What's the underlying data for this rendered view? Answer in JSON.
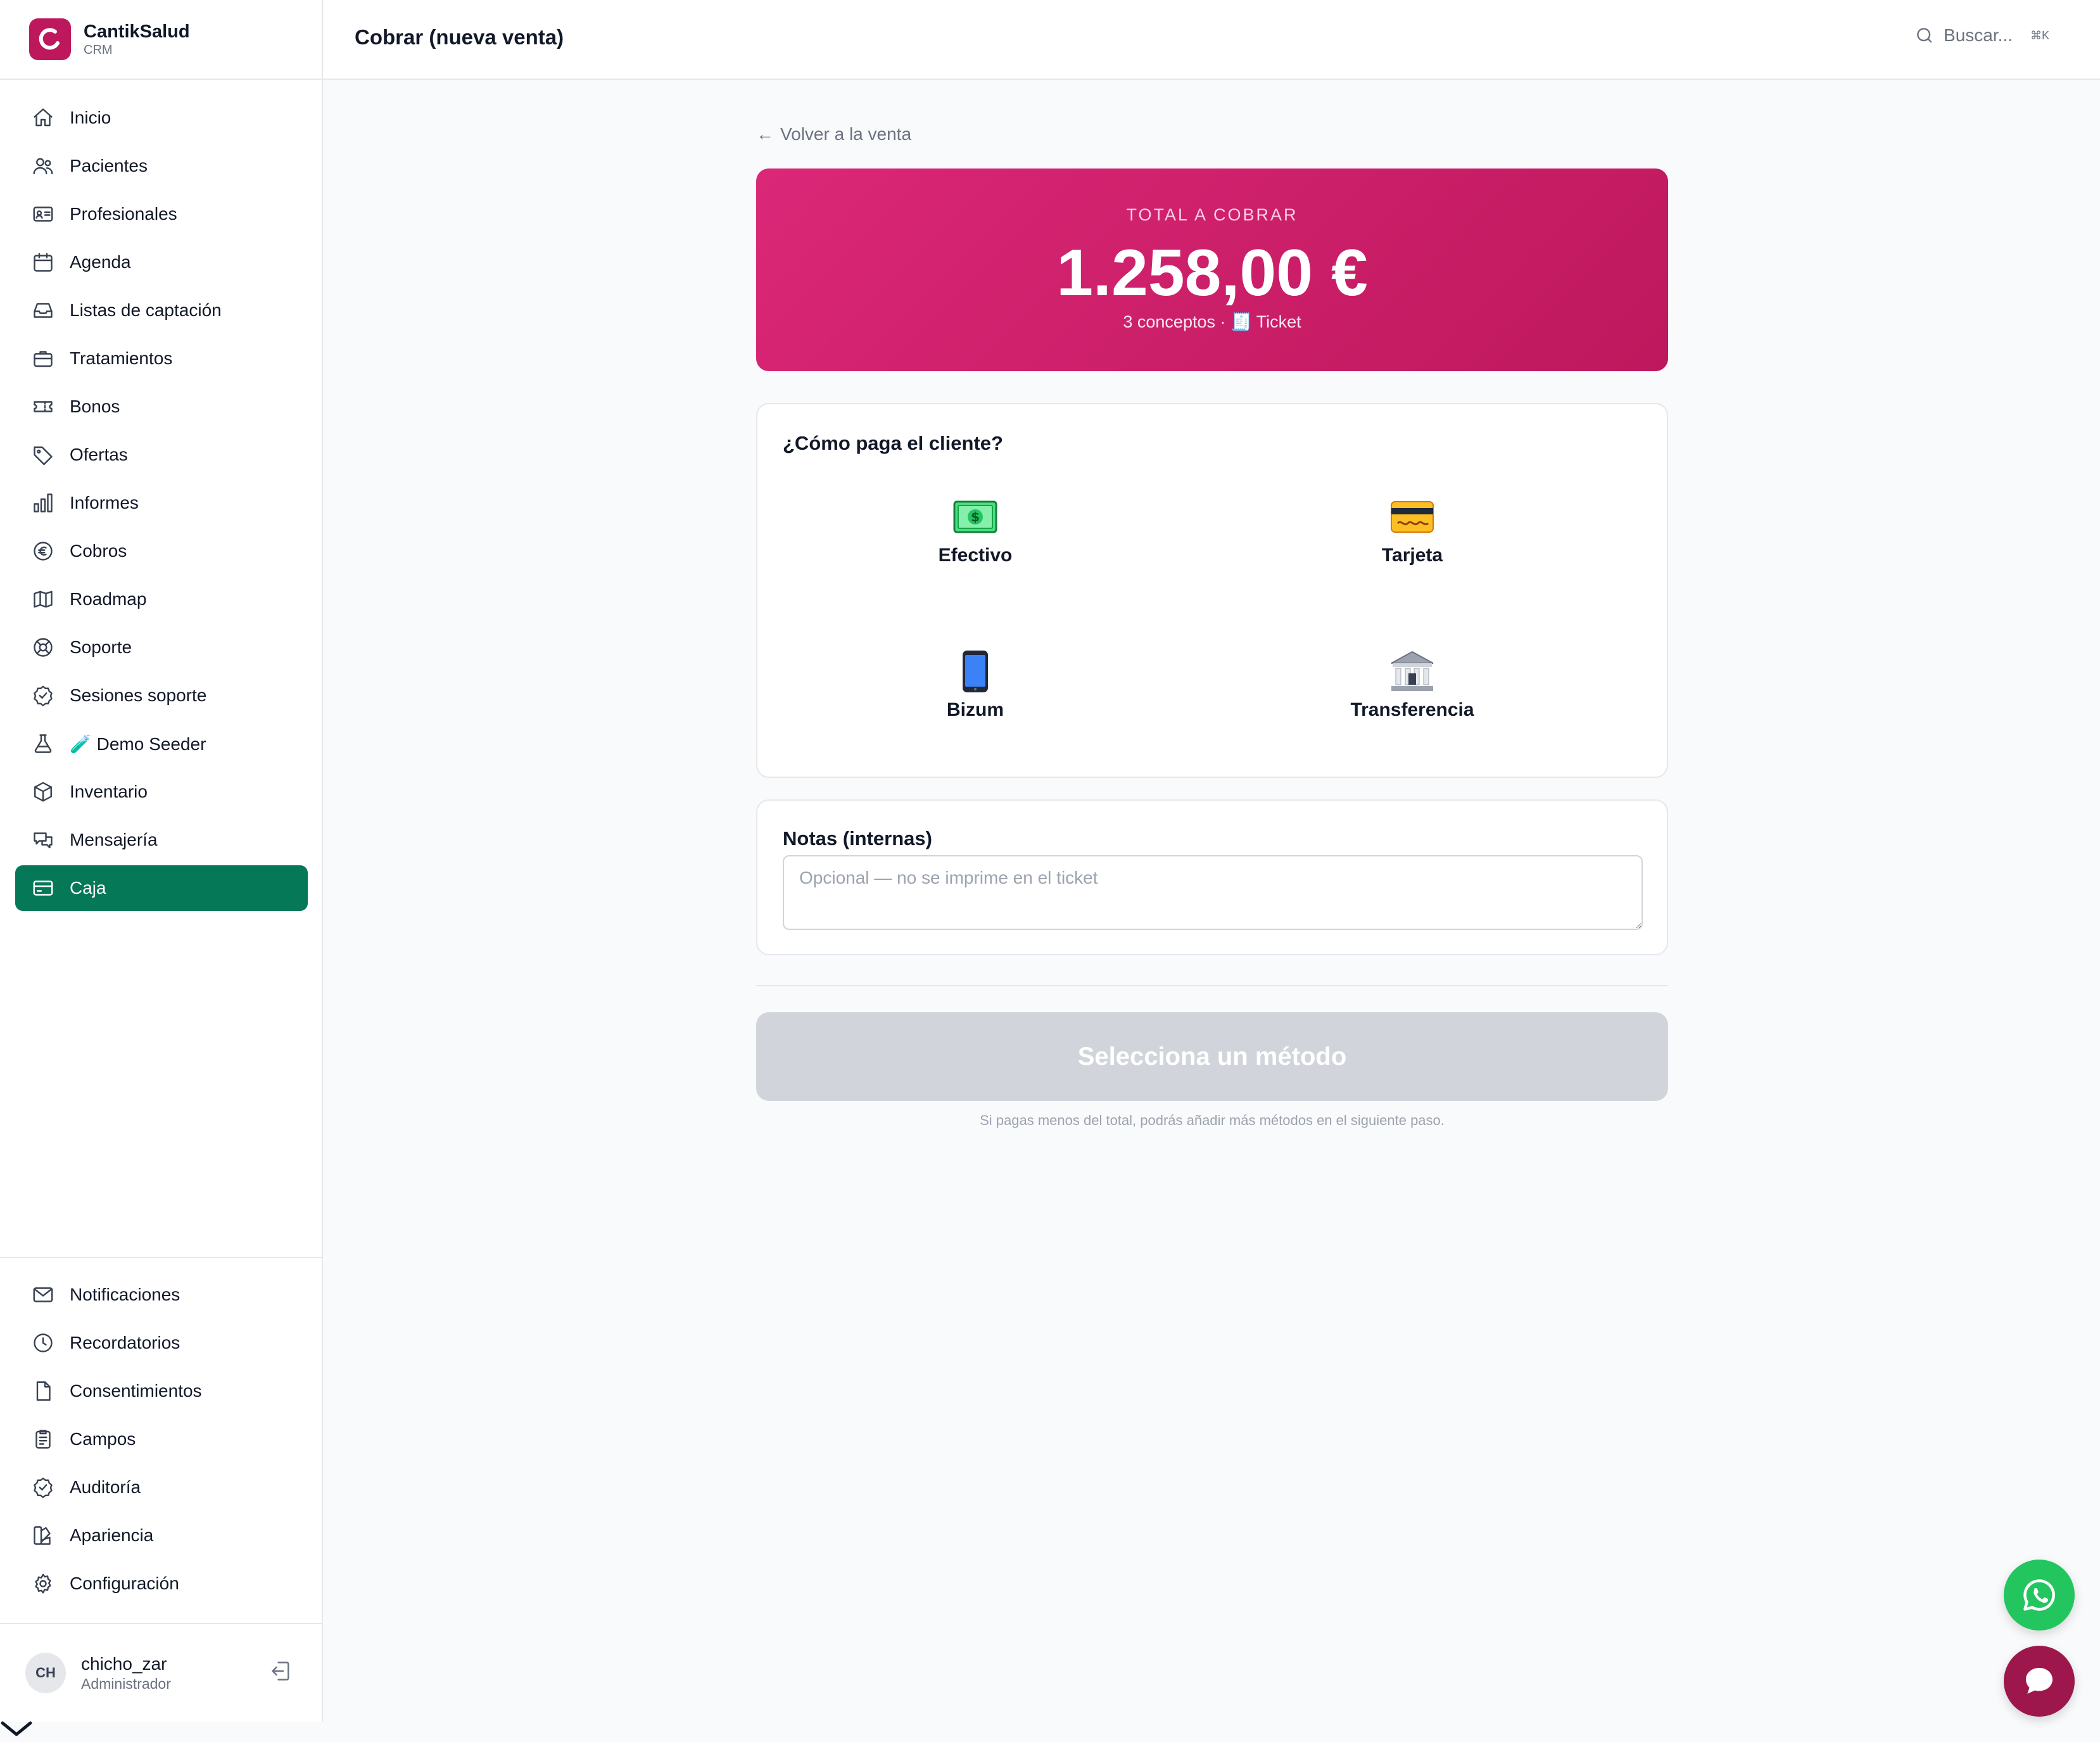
{
  "app": {
    "name": "CantikSalud",
    "subtitle": "CRM"
  },
  "header": {
    "title": "Cobrar (nueva venta)",
    "search_placeholder": "Buscar...",
    "shortcut": "⌘K"
  },
  "sidebar": {
    "items": [
      {
        "label": "Inicio",
        "icon": "home-icon"
      },
      {
        "label": "Pacientes",
        "icon": "users-icon"
      },
      {
        "label": "Profesionales",
        "icon": "id-card-icon"
      },
      {
        "label": "Agenda",
        "icon": "calendar-icon"
      },
      {
        "label": "Listas de captación",
        "icon": "inbox-icon"
      },
      {
        "label": "Tratamientos",
        "icon": "briefcase-icon"
      },
      {
        "label": "Bonos",
        "icon": "ticket-icon"
      },
      {
        "label": "Ofertas",
        "icon": "tag-icon"
      },
      {
        "label": "Informes",
        "icon": "bar-chart-icon"
      },
      {
        "label": "Cobros",
        "icon": "euro-icon"
      },
      {
        "label": "Roadmap",
        "icon": "map-icon"
      },
      {
        "label": "Soporte",
        "icon": "lifebuoy-icon"
      },
      {
        "label": "Sesiones soporte",
        "icon": "check-badge-icon"
      },
      {
        "label": "🧪 Demo Seeder",
        "icon": "flask-icon"
      },
      {
        "label": "Inventario",
        "icon": "box-icon"
      },
      {
        "label": "Mensajería",
        "icon": "chat-bubbles-icon"
      },
      {
        "label": "Caja",
        "icon": "credit-card-icon",
        "active": true
      }
    ],
    "bottom_items": [
      {
        "label": "Notificaciones",
        "icon": "envelope-icon"
      },
      {
        "label": "Recordatorios",
        "icon": "clock-icon"
      },
      {
        "label": "Consentimientos",
        "icon": "document-icon"
      },
      {
        "label": "Campos",
        "icon": "clipboard-icon"
      },
      {
        "label": "Auditoría",
        "icon": "check-badge-icon"
      },
      {
        "label": "Apariencia",
        "icon": "palette-icon"
      },
      {
        "label": "Configuración",
        "icon": "gear-icon"
      }
    ]
  },
  "user": {
    "initials": "CH",
    "name": "chicho_zar",
    "role": "Administrador"
  },
  "main": {
    "back_label": "Volver a la venta",
    "total": {
      "label": "TOTAL A COBRAR",
      "amount": "1.258,00 €",
      "meta": "3 conceptos · 🧾 Ticket"
    },
    "payment": {
      "title": "¿Cómo paga el cliente?",
      "methods": [
        {
          "label": "Efectivo",
          "icon": "cash-icon"
        },
        {
          "label": "Tarjeta",
          "icon": "card-icon"
        },
        {
          "label": "Bizum",
          "icon": "phone-icon"
        },
        {
          "label": "Transferencia",
          "icon": "bank-icon"
        }
      ]
    },
    "notes": {
      "title": "Notas (internas)",
      "placeholder": "Opcional — no se imprime en el ticket",
      "value": ""
    },
    "submit_label": "Selecciona un método",
    "help": "Si pagas menos del total, podrás añadir más métodos en el siguiente paso."
  },
  "colors": {
    "brand": "#be185d",
    "active_nav": "#047857",
    "whatsapp": "#22c55e",
    "chat": "#9d174d"
  }
}
